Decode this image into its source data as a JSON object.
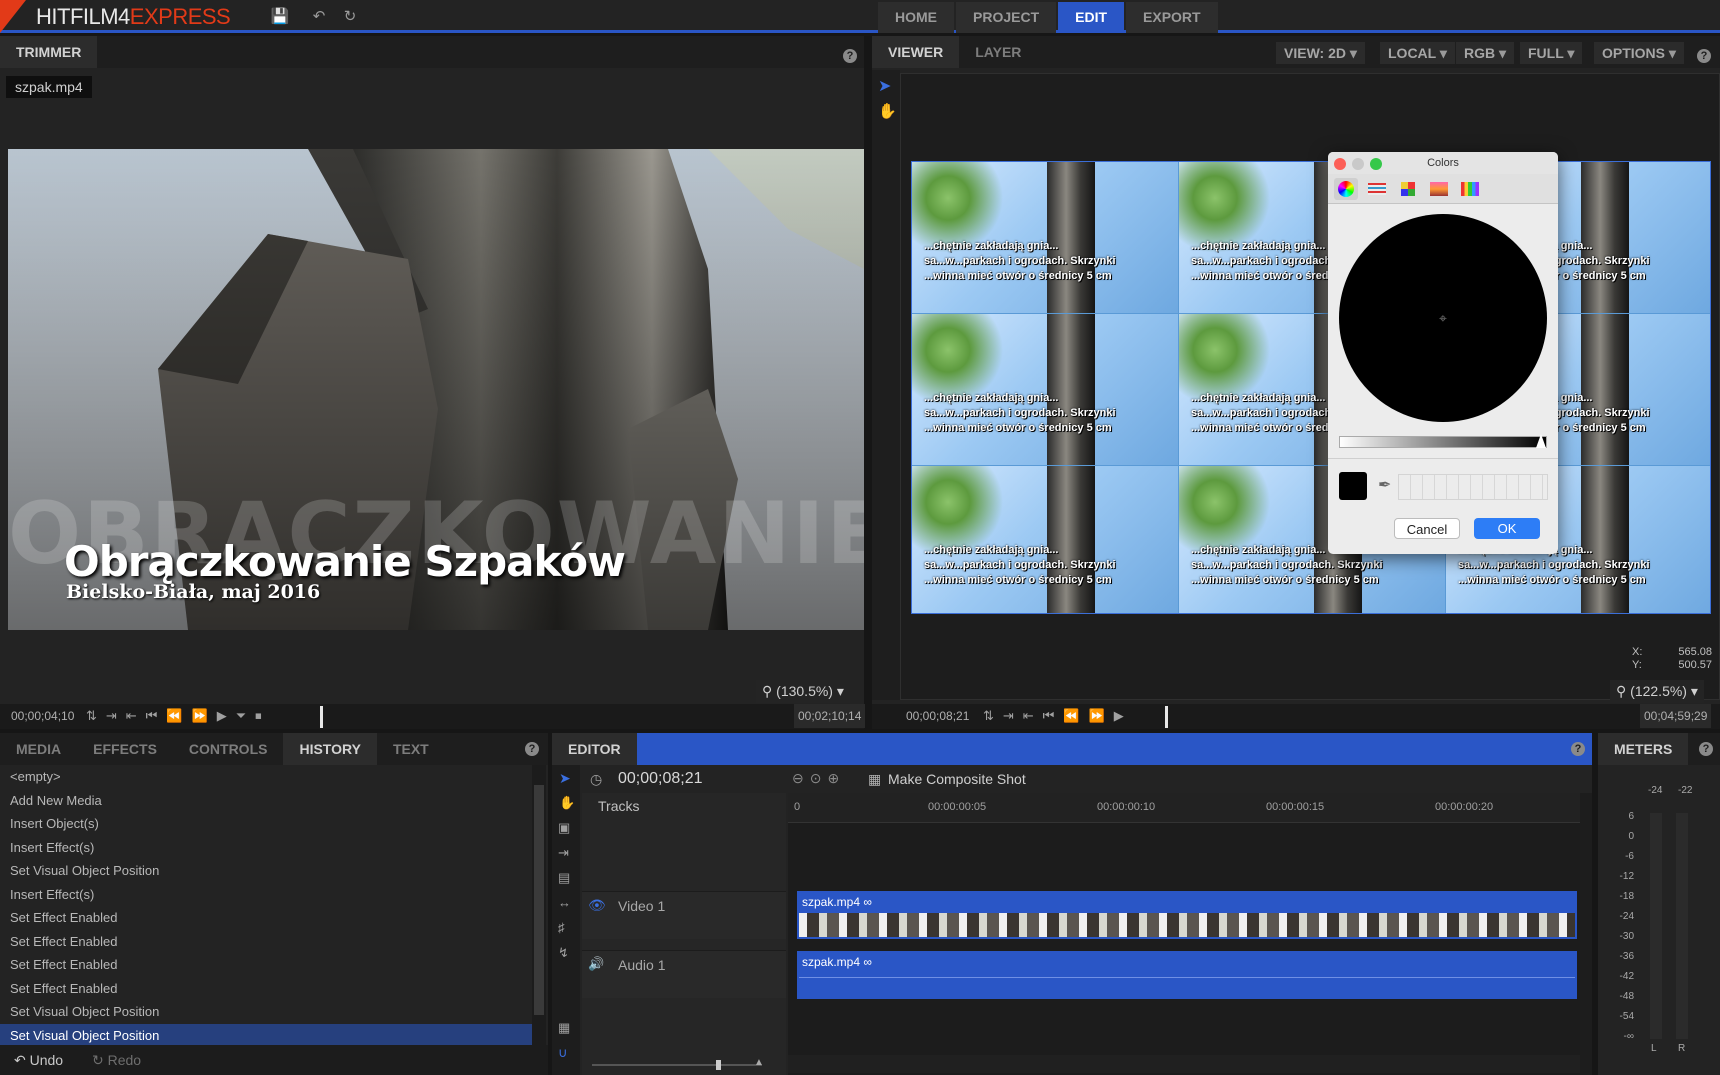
{
  "app": {
    "logo_prefix": "HITFILM4",
    "logo_suffix": "EXPRESS",
    "nav": [
      "HOME",
      "PROJECT",
      "EDIT",
      "EXPORT"
    ],
    "nav_active": "EDIT"
  },
  "trimmer": {
    "tab": "TRIMMER",
    "file": "szpak.mp4",
    "title_text": "Obrączkowanie Szpaków",
    "subtitle_text": "Bielsko-Biała, maj 2016",
    "bg_text": "OBRĄCZKOWANIE SZPAKÓW",
    "zoom": "(130.5%)",
    "time_current": "00;00;04;10",
    "time_end": "00;02;10;14"
  },
  "viewer": {
    "tabs": [
      "VIEWER",
      "LAYER"
    ],
    "options": [
      "VIEW: 2D",
      "LOCAL",
      "RGB",
      "FULL",
      "OPTIONS"
    ],
    "overlay_lines": [
      "...chętnie zakładają gnia...",
      "sa...w...parkach i ogrodach. Skrzynki",
      "...winna mieć otwór o średnicy 5 cm"
    ],
    "x_label": "X:",
    "x_value": "565.08",
    "y_label": "Y:",
    "y_value": "500.57",
    "zoom": "(122.5%)",
    "time_current": "00;00;08;21",
    "time_end": "00;04;59;29"
  },
  "colors_dialog": {
    "title": "Colors",
    "cancel": "Cancel",
    "ok": "OK",
    "current_color": "#000000"
  },
  "history": {
    "tabs": [
      "MEDIA",
      "EFFECTS",
      "CONTROLS",
      "HISTORY",
      "TEXT"
    ],
    "active_tab": "HISTORY",
    "items": [
      "<empty>",
      "Add New Media",
      "Insert Object(s)",
      "Insert Effect(s)",
      "Set Visual Object Position",
      "Insert Effect(s)",
      "Set Effect Enabled",
      "Set Effect Enabled",
      "Set Effect Enabled",
      "Set Effect Enabled",
      "Set Visual Object Position",
      "Set Visual Object Position"
    ],
    "selected_index": 11,
    "undo": "Undo",
    "redo": "Redo"
  },
  "editor": {
    "tab": "EDITOR",
    "timecode": "00;00;08;21",
    "composite": "Make Composite Shot",
    "tracks_label": "Tracks",
    "ruler": [
      "0",
      "00:00:00:05",
      "00:00:00:10",
      "00:00:00:15",
      "00:00:00:20"
    ],
    "video_track": "Video 1",
    "audio_track": "Audio 1",
    "video_clip": "szpak.mp4",
    "audio_clip": "szpak.mp4"
  },
  "meters": {
    "tab": "METERS",
    "peak_left": "-24",
    "peak_right": "-22",
    "scale": [
      "6",
      "0",
      "-6",
      "-12",
      "-18",
      "-24",
      "-30",
      "-36",
      "-42",
      "-48",
      "-54",
      "-∞"
    ],
    "left_label": "L",
    "right_label": "R"
  }
}
